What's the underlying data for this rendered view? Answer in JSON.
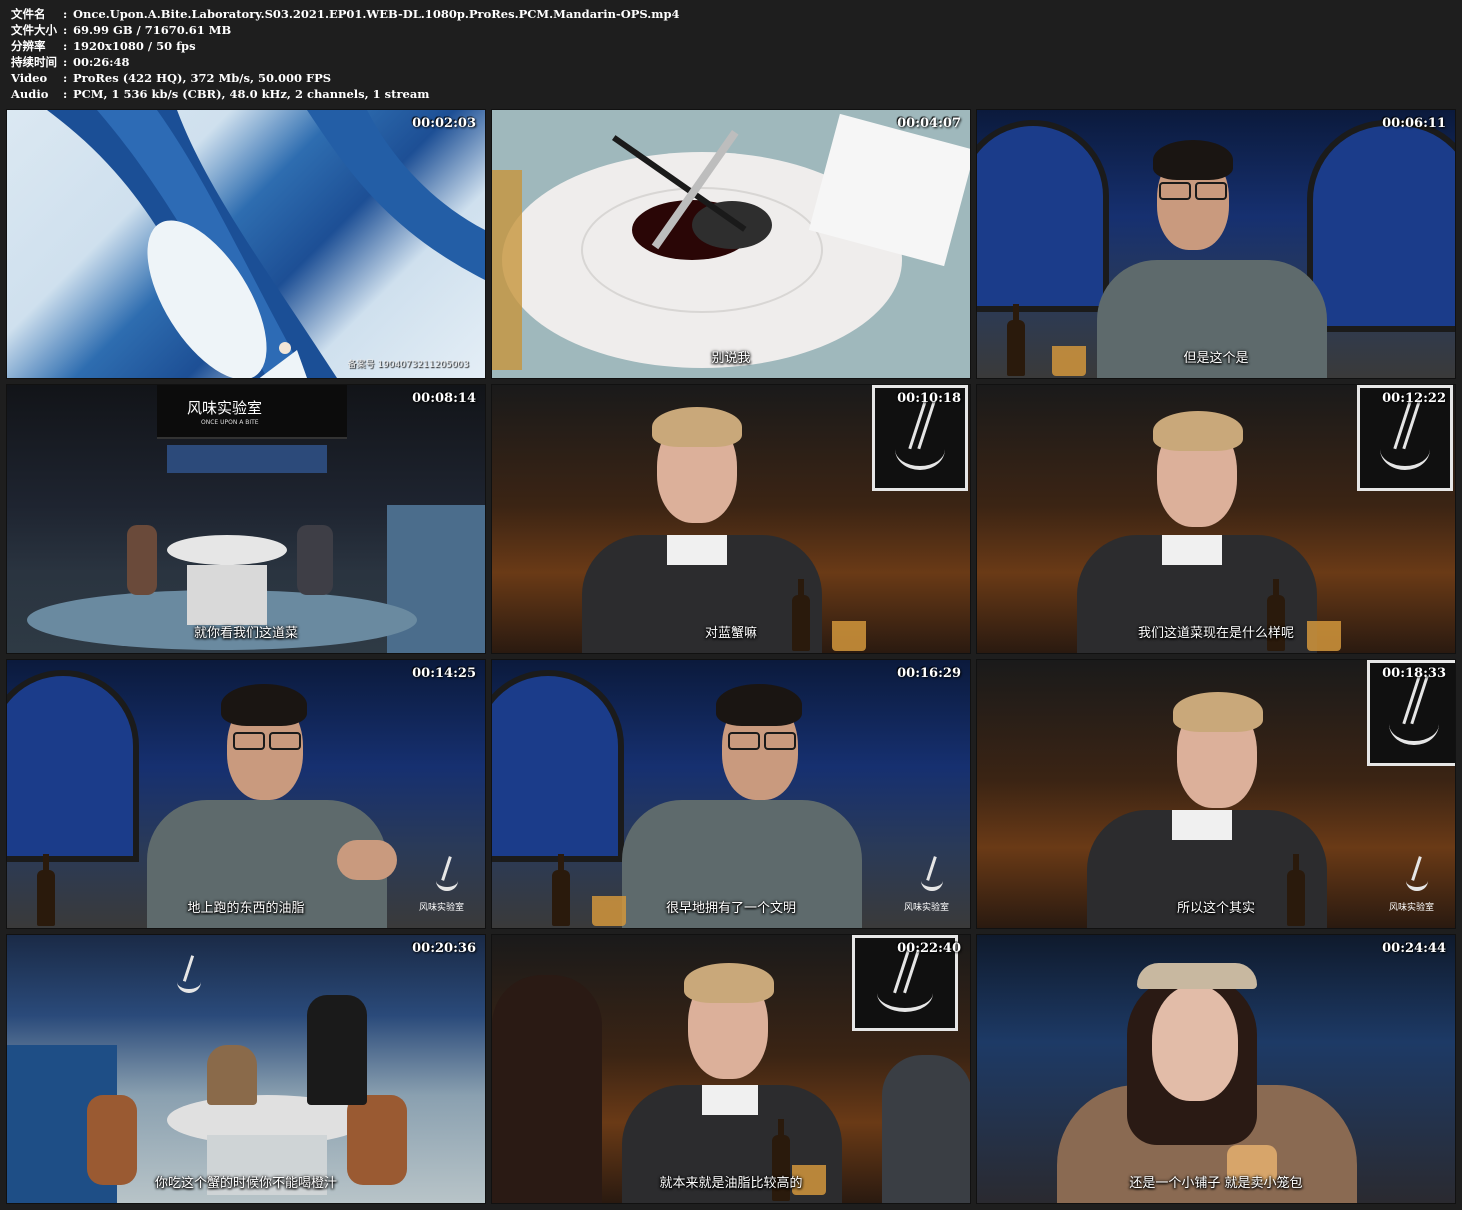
{
  "header": {
    "rows": [
      {
        "label": "文件名",
        "value": "Once.Upon.A.Bite.Laboratory.S03.2021.EP01.WEB-DL.1080p.ProRes.PCM.Mandarin-OPS.mp4"
      },
      {
        "label": "文件大小",
        "value": "69.99 GB  / 71670.61 MB"
      },
      {
        "label": "分辨率",
        "value": "1920x1080 / 50 fps"
      },
      {
        "label": "持续时间",
        "value": "00:26:48"
      },
      {
        "label": "Video",
        "value": "ProRes (422 HQ), 372 Mb/s, 50.000 FPS"
      },
      {
        "label": "Audio",
        "value": "PCM, 1 536 kb/s (CBR), 48.0 kHz, 2 channels, 1 stream"
      }
    ]
  },
  "frames": [
    {
      "timestamp": "00:02:03",
      "subtitle": "",
      "watermark": "备案号 1904073211205003"
    },
    {
      "timestamp": "00:04:07",
      "subtitle": "别说我"
    },
    {
      "timestamp": "00:06:11",
      "subtitle": "但是这个是"
    },
    {
      "timestamp": "00:08:14",
      "subtitle": "就你看我们这道菜",
      "sign_title": "风味实验室",
      "sign_sub": "ONCE UPON A BITE"
    },
    {
      "timestamp": "00:10:18",
      "subtitle": "对蓝蟹嘛"
    },
    {
      "timestamp": "00:12:22",
      "subtitle": "我们这道菜现在是什么样呢"
    },
    {
      "timestamp": "00:14:25",
      "subtitle": "地上跑的东西的油脂"
    },
    {
      "timestamp": "00:16:29",
      "subtitle": "很早地拥有了一个文明"
    },
    {
      "timestamp": "00:18:33",
      "subtitle": "所以这个其实"
    },
    {
      "timestamp": "00:20:36",
      "subtitle": "你吃这个蟹的时候你不能喝橙汁"
    },
    {
      "timestamp": "00:22:40",
      "subtitle": "就本来就是油脂比较高的"
    },
    {
      "timestamp": "00:24:44",
      "subtitle": "还是一个小铺子 就是卖小笼包"
    }
  ],
  "logo_caption": {
    "cn": "风味实验室",
    "en": "ONCE UPON A BITE"
  }
}
